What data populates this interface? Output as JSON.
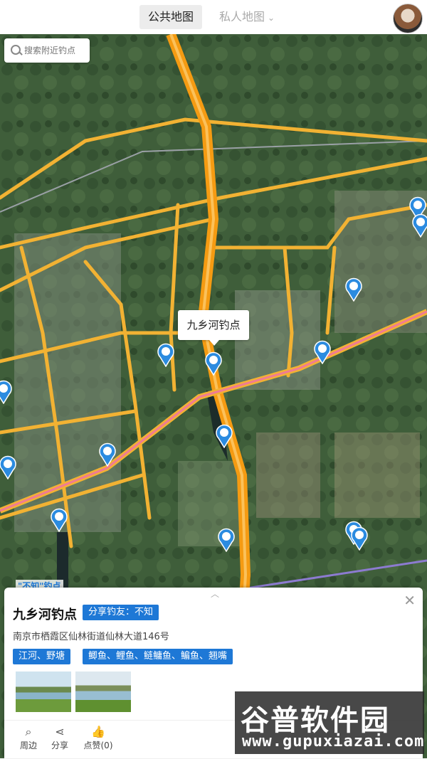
{
  "header": {
    "tab_public": "公共地图",
    "tab_private": "私人地图",
    "chevron": "⌄"
  },
  "search": {
    "placeholder": "搜索附近钓点"
  },
  "map": {
    "callout": "九乡河钓点",
    "poi_label": "\"不知\"钓点"
  },
  "panel": {
    "collapse": "︿",
    "close": "✕",
    "title": "九乡河钓点",
    "share": "分享钓友：不知",
    "address": "南京市栖霞区仙林街道仙林大道146号",
    "tags": [
      "江河、野塘",
      "鲫鱼、鲤鱼、鲢鳙鱼、鳊鱼、翘嘴"
    ],
    "actions": [
      {
        "label": "周边",
        "icon": "search-icon"
      },
      {
        "label": "分享",
        "icon": "share-icon"
      },
      {
        "label": "点赞(0)",
        "icon": "thumb-up-icon"
      }
    ]
  },
  "watermark": {
    "line1": "谷普软件园",
    "line2": "www.gupuxiazai.com"
  },
  "colors": {
    "accent": "#1e78d6",
    "road": "#f2b233",
    "highway": "#f59b12",
    "rail": "#f07b93"
  }
}
